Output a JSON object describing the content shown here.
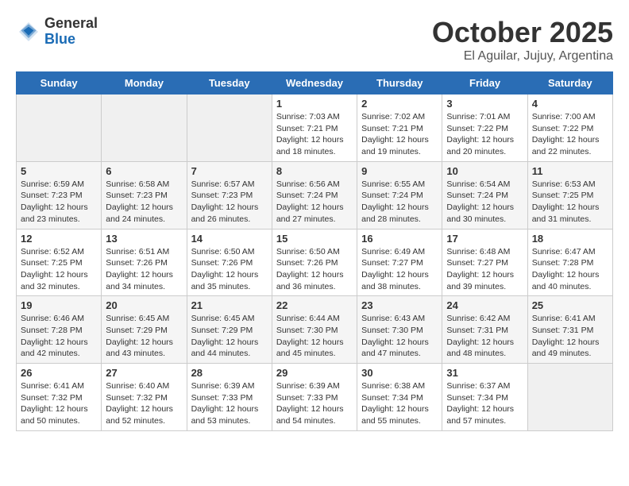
{
  "logo": {
    "general": "General",
    "blue": "Blue"
  },
  "title": "October 2025",
  "subtitle": "El Aguilar, Jujuy, Argentina",
  "days_of_week": [
    "Sunday",
    "Monday",
    "Tuesday",
    "Wednesday",
    "Thursday",
    "Friday",
    "Saturday"
  ],
  "weeks": [
    [
      {
        "day": "",
        "info": ""
      },
      {
        "day": "",
        "info": ""
      },
      {
        "day": "",
        "info": ""
      },
      {
        "day": "1",
        "info": "Sunrise: 7:03 AM\nSunset: 7:21 PM\nDaylight: 12 hours and 18 minutes."
      },
      {
        "day": "2",
        "info": "Sunrise: 7:02 AM\nSunset: 7:21 PM\nDaylight: 12 hours and 19 minutes."
      },
      {
        "day": "3",
        "info": "Sunrise: 7:01 AM\nSunset: 7:22 PM\nDaylight: 12 hours and 20 minutes."
      },
      {
        "day": "4",
        "info": "Sunrise: 7:00 AM\nSunset: 7:22 PM\nDaylight: 12 hours and 22 minutes."
      }
    ],
    [
      {
        "day": "5",
        "info": "Sunrise: 6:59 AM\nSunset: 7:23 PM\nDaylight: 12 hours and 23 minutes."
      },
      {
        "day": "6",
        "info": "Sunrise: 6:58 AM\nSunset: 7:23 PM\nDaylight: 12 hours and 24 minutes."
      },
      {
        "day": "7",
        "info": "Sunrise: 6:57 AM\nSunset: 7:23 PM\nDaylight: 12 hours and 26 minutes."
      },
      {
        "day": "8",
        "info": "Sunrise: 6:56 AM\nSunset: 7:24 PM\nDaylight: 12 hours and 27 minutes."
      },
      {
        "day": "9",
        "info": "Sunrise: 6:55 AM\nSunset: 7:24 PM\nDaylight: 12 hours and 28 minutes."
      },
      {
        "day": "10",
        "info": "Sunrise: 6:54 AM\nSunset: 7:24 PM\nDaylight: 12 hours and 30 minutes."
      },
      {
        "day": "11",
        "info": "Sunrise: 6:53 AM\nSunset: 7:25 PM\nDaylight: 12 hours and 31 minutes."
      }
    ],
    [
      {
        "day": "12",
        "info": "Sunrise: 6:52 AM\nSunset: 7:25 PM\nDaylight: 12 hours and 32 minutes."
      },
      {
        "day": "13",
        "info": "Sunrise: 6:51 AM\nSunset: 7:26 PM\nDaylight: 12 hours and 34 minutes."
      },
      {
        "day": "14",
        "info": "Sunrise: 6:50 AM\nSunset: 7:26 PM\nDaylight: 12 hours and 35 minutes."
      },
      {
        "day": "15",
        "info": "Sunrise: 6:50 AM\nSunset: 7:26 PM\nDaylight: 12 hours and 36 minutes."
      },
      {
        "day": "16",
        "info": "Sunrise: 6:49 AM\nSunset: 7:27 PM\nDaylight: 12 hours and 38 minutes."
      },
      {
        "day": "17",
        "info": "Sunrise: 6:48 AM\nSunset: 7:27 PM\nDaylight: 12 hours and 39 minutes."
      },
      {
        "day": "18",
        "info": "Sunrise: 6:47 AM\nSunset: 7:28 PM\nDaylight: 12 hours and 40 minutes."
      }
    ],
    [
      {
        "day": "19",
        "info": "Sunrise: 6:46 AM\nSunset: 7:28 PM\nDaylight: 12 hours and 42 minutes."
      },
      {
        "day": "20",
        "info": "Sunrise: 6:45 AM\nSunset: 7:29 PM\nDaylight: 12 hours and 43 minutes."
      },
      {
        "day": "21",
        "info": "Sunrise: 6:45 AM\nSunset: 7:29 PM\nDaylight: 12 hours and 44 minutes."
      },
      {
        "day": "22",
        "info": "Sunrise: 6:44 AM\nSunset: 7:30 PM\nDaylight: 12 hours and 45 minutes."
      },
      {
        "day": "23",
        "info": "Sunrise: 6:43 AM\nSunset: 7:30 PM\nDaylight: 12 hours and 47 minutes."
      },
      {
        "day": "24",
        "info": "Sunrise: 6:42 AM\nSunset: 7:31 PM\nDaylight: 12 hours and 48 minutes."
      },
      {
        "day": "25",
        "info": "Sunrise: 6:41 AM\nSunset: 7:31 PM\nDaylight: 12 hours and 49 minutes."
      }
    ],
    [
      {
        "day": "26",
        "info": "Sunrise: 6:41 AM\nSunset: 7:32 PM\nDaylight: 12 hours and 50 minutes."
      },
      {
        "day": "27",
        "info": "Sunrise: 6:40 AM\nSunset: 7:32 PM\nDaylight: 12 hours and 52 minutes."
      },
      {
        "day": "28",
        "info": "Sunrise: 6:39 AM\nSunset: 7:33 PM\nDaylight: 12 hours and 53 minutes."
      },
      {
        "day": "29",
        "info": "Sunrise: 6:39 AM\nSunset: 7:33 PM\nDaylight: 12 hours and 54 minutes."
      },
      {
        "day": "30",
        "info": "Sunrise: 6:38 AM\nSunset: 7:34 PM\nDaylight: 12 hours and 55 minutes."
      },
      {
        "day": "31",
        "info": "Sunrise: 6:37 AM\nSunset: 7:34 PM\nDaylight: 12 hours and 57 minutes."
      },
      {
        "day": "",
        "info": ""
      }
    ]
  ]
}
